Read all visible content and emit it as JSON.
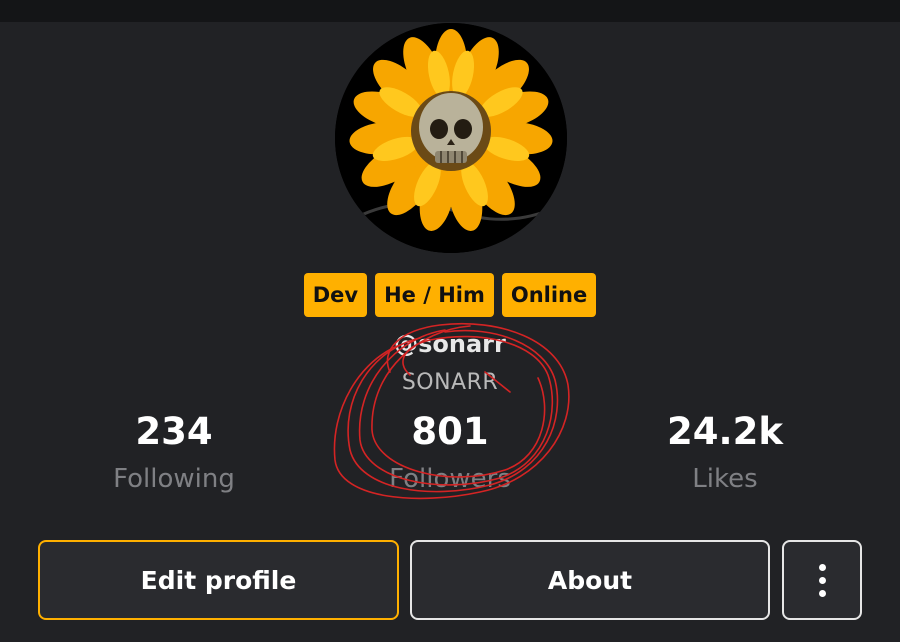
{
  "profile": {
    "badges": [
      "Dev",
      "He / Him",
      "Online"
    ],
    "handle": "@sonarr",
    "display_name": "SONARR"
  },
  "stats": {
    "following": {
      "value": "234",
      "label": "Following"
    },
    "followers": {
      "value": "801",
      "label": "Followers"
    },
    "likes": {
      "value": "24.2k",
      "label": "Likes"
    }
  },
  "actions": {
    "edit_label": "Edit profile",
    "about_label": "About",
    "more_icon": "vertical-ellipsis-icon"
  },
  "colors": {
    "background": "#212225",
    "accent": "#ffb000",
    "annotation": "#d42424"
  },
  "avatar": {
    "icon": "sunflower-skull-avatar"
  }
}
